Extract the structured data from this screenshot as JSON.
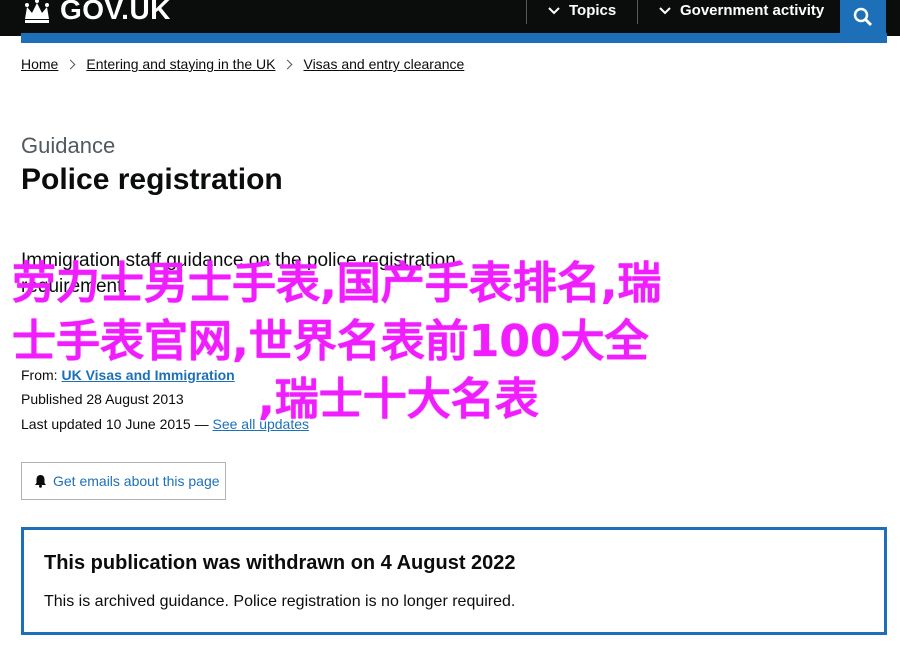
{
  "header": {
    "logo_text": "GOV.UK",
    "topics_label": "Topics",
    "gov_activity_label": "Government activity",
    "colors": {
      "background": "#0b0c0c",
      "accent": "#1d70b8"
    }
  },
  "breadcrumb": [
    "Home",
    "Entering and staying in the UK",
    "Visas and entry clearance"
  ],
  "page": {
    "caption": "Guidance",
    "title": "Police registration",
    "description": "Immigration staff guidance on the police registration requirement."
  },
  "overlay": {
    "line1": "劳力士男士手表,国产手表排名,瑞",
    "line2": "士手表官网,世界名表前100大全",
    "line3": ",瑞士十大名表",
    "color": "#f01dff"
  },
  "metadata": {
    "from_label": "From:",
    "from_value": "UK Visas and Immigration",
    "published_label": "Published",
    "published_value": "28 August 2013",
    "updated_label": "Last updated",
    "updated_value": "10 June 2015",
    "updated_sep": "—",
    "see_all_updates": "See all updates"
  },
  "email_button": {
    "label": "Get emails about this page",
    "icon": "bell-icon"
  },
  "notice": {
    "title": "This publication was withdrawn on 4 August 2022",
    "body": "This is archived guidance. Police registration is no longer required."
  }
}
